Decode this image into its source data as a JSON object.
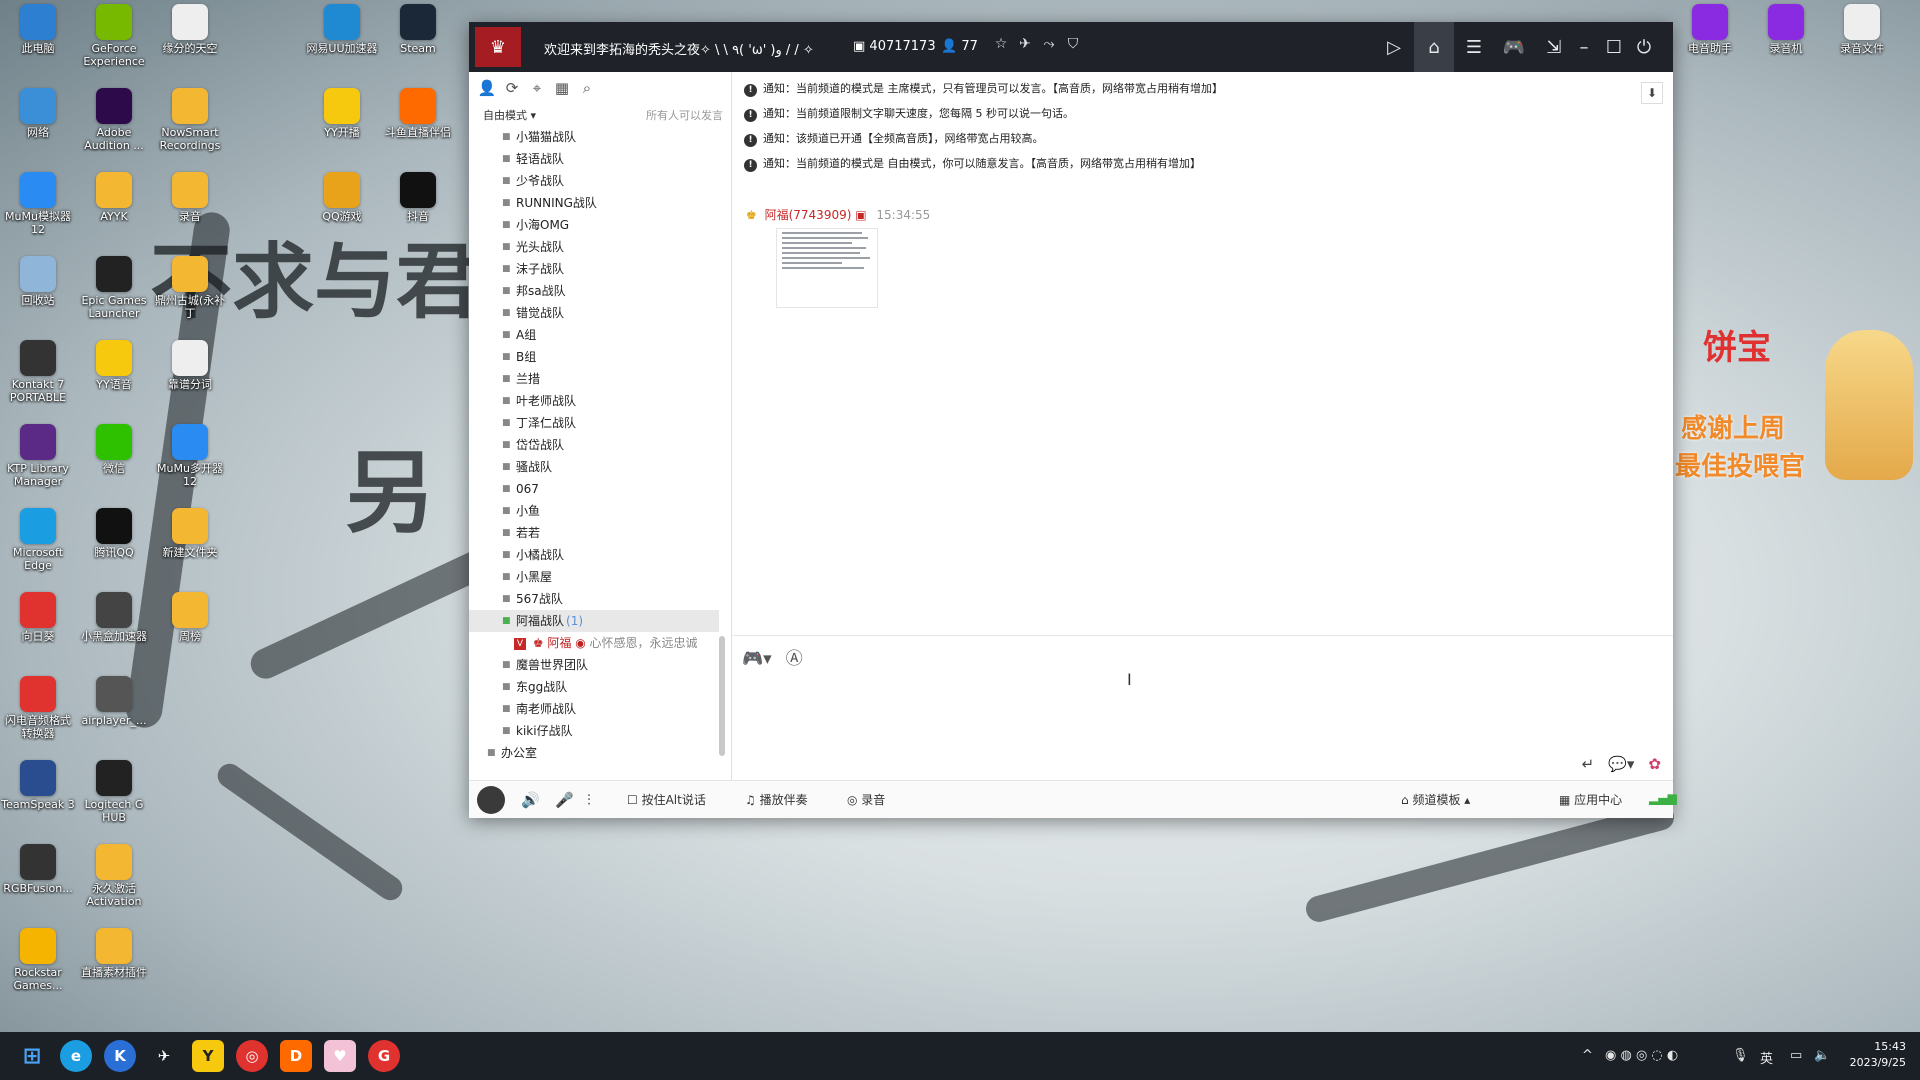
{
  "desktop": {
    "icons": [
      {
        "label": "此电脑",
        "color": "#2c7fd1"
      },
      {
        "label": "GeForce Experience",
        "color": "#76b900"
      },
      {
        "label": "缘分的天空",
        "color": "#eeeeee"
      },
      {
        "label": "网易UU加速器",
        "color": "#1f8ad1"
      },
      {
        "label": "Steam",
        "color": "#1b2838"
      },
      {
        "label": "网络",
        "color": "#3a8fd6"
      },
      {
        "label": "Adobe Audition ...",
        "color": "#2d0b4a"
      },
      {
        "label": "NowSmart Recordings",
        "color": "#f4b731"
      },
      {
        "label": "YY开播",
        "color": "#f6c90e"
      },
      {
        "label": "斗鱼直播伴侣",
        "color": "#ff6a00"
      },
      {
        "label": "MuMu模拟器12",
        "color": "#2a8bf2"
      },
      {
        "label": "AYYK",
        "color": "#f4b731"
      },
      {
        "label": "录音",
        "color": "#f4b731"
      },
      {
        "label": "QQ游戏",
        "color": "#e8a31b"
      },
      {
        "label": "抖音",
        "color": "#111111"
      },
      {
        "label": "回收站",
        "color": "#8fb6d8"
      },
      {
        "label": "Epic Games Launcher",
        "color": "#222222"
      },
      {
        "label": "鼎州古城(永补丁",
        "color": "#f4b731"
      },
      {
        "label": "Kontakt 7 PORTABLE",
        "color": "#333333"
      },
      {
        "label": "YY语音",
        "color": "#f6c90e"
      },
      {
        "label": "靠谱分词",
        "color": "#eeeeee"
      },
      {
        "label": "KTP Library Manager",
        "color": "#5b2a86"
      },
      {
        "label": "微信",
        "color": "#2dc100"
      },
      {
        "label": "MuMu多开器12",
        "color": "#2a8bf2"
      },
      {
        "label": "Microsoft Edge",
        "color": "#1b9de2"
      },
      {
        "label": "腾讯QQ",
        "color": "#111111"
      },
      {
        "label": "新建文件夹",
        "color": "#f4b731"
      },
      {
        "label": "向日葵",
        "color": "#e0322e"
      },
      {
        "label": "小黑盒加速器",
        "color": "#444444"
      },
      {
        "label": "周榜",
        "color": "#f4b731"
      },
      {
        "label": "闪电音频格式转换器",
        "color": "#e0322e"
      },
      {
        "label": "airplayer_...",
        "color": "#555555"
      },
      {
        "label": "TeamSpeak 3",
        "color": "#2a4d8f"
      },
      {
        "label": "Logitech G HUB",
        "color": "#222222"
      },
      {
        "label": "RGBFusion...",
        "color": "#333333"
      },
      {
        "label": "永久激活 Activation",
        "color": "#f4b731"
      },
      {
        "label": "Rockstar Games...",
        "color": "#f5b400"
      },
      {
        "label": "直播素材插件",
        "color": "#f4b731"
      },
      {
        "label": "电音助手",
        "color": "#8a2be2"
      },
      {
        "label": "录音机",
        "color": "#8a2be2"
      },
      {
        "label": "录音文件",
        "color": "#eeeeee"
      }
    ],
    "wallpaper_text": {
      "line1": "不求与君",
      "line2": "另",
      "sticker_name": "饼宝",
      "sticker_line1": "感谢上周",
      "sticker_line2": "最佳投喂官"
    }
  },
  "window": {
    "title": "欢迎来到李拓海的秃头之夜✧ \\ \\ ٩( 'ω' )و / / ✧",
    "channel_id": "40717173",
    "user_count": "77",
    "titlebar_icons": [
      "star-icon",
      "plane-icon",
      "share-icon",
      "shield-icon"
    ],
    "titlebar_buttons": [
      "video-icon",
      "home-icon",
      "list-icon",
      "gamepad-icon",
      "download-icon",
      "minimize-icon",
      "maximize-icon",
      "power-icon"
    ]
  },
  "left_panel": {
    "mode": "自由模式",
    "mode_hint": "所有人可以发言",
    "channels": [
      "小猫猫战队",
      "轻语战队",
      "少爷战队",
      "RUNNING战队",
      "小海OMG",
      "光头战队",
      "沫子战队",
      "邦sa战队",
      "错觉战队",
      "A组",
      "B组",
      "兰措",
      "叶老师战队",
      "丁泽仁战队",
      "岱岱战队",
      "骚战队",
      "067",
      "小鱼",
      "若若",
      "小橘战队",
      "小黑屋",
      "567战队"
    ],
    "selected_channel": {
      "name": "阿福战队",
      "count": "(1)"
    },
    "member": {
      "name": "阿福",
      "signature": "心怀感恩，永远忠诚"
    },
    "channels_after": [
      "魔兽世界团队",
      "东gg战队",
      "南老师战队",
      "kiki仔战队"
    ],
    "root": "办公室"
  },
  "chat": {
    "notices": [
      "通知：当前频道的模式是 主席模式，只有管理员可以发言。【高音质，网络带宽占用稍有增加】",
      "通知：当前频道限制文字聊天速度，您每隔 5 秒可以说一句话。",
      "通知：该频道已开通【全频高音质】，网络带宽占用较高。",
      "通知：当前频道的模式是 自由模式，你可以随意发言。【高音质，网络带宽占用稍有增加】"
    ],
    "message": {
      "sender": "阿福(7743909)",
      "time": "15:34:55"
    }
  },
  "bottom_bar": {
    "ptt_label": "按住Alt说话",
    "music_label": "播放伴奏",
    "record_label": "录音",
    "template_label": "频道模板",
    "app_center_label": "应用中心"
  },
  "taskbar": {
    "ime": "英",
    "time": "15:43",
    "date": "2023/9/25"
  }
}
